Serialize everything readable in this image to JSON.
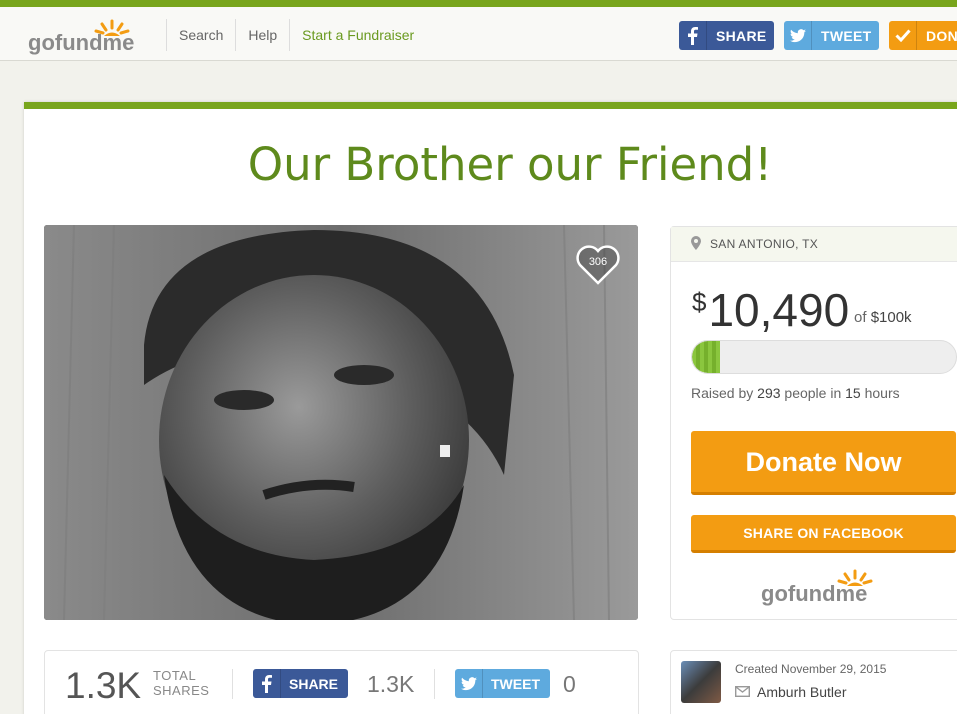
{
  "header": {
    "logo_text": "gofundme",
    "nav": [
      {
        "label": "Search"
      },
      {
        "label": "Help"
      },
      {
        "label": "Start a Fundraiser"
      }
    ],
    "share_label": "SHARE",
    "tweet_label": "TWEET",
    "donate_label": "DON"
  },
  "campaign": {
    "title": "Our Brother our Friend!",
    "heart_count": "306"
  },
  "sidebar": {
    "location": "SAN ANTONIO, TX",
    "currency": "$",
    "amount": "10,490",
    "goal_prefix": "of",
    "goal": "$100k",
    "progress_fraction": 0.105,
    "raised_prefix": "Raised by",
    "raised_people": "293",
    "raised_mid": "people in",
    "raised_hours": "15",
    "raised_suffix": "hours",
    "donate_label": "Donate Now",
    "share_fb_label": "SHARE ON FACEBOOK",
    "logo_text": "gofundme"
  },
  "share_bar": {
    "total_count": "1.3K",
    "total_label_1": "TOTAL",
    "total_label_2": "SHARES",
    "fb_label": "SHARE",
    "fb_count": "1.3K",
    "tw_label": "TWEET",
    "tw_count": "0"
  },
  "creator": {
    "created": "Created November 29, 2015",
    "name": "Amburh Butler"
  },
  "colors": {
    "brand_green": "#78a51c",
    "title_green": "#5e8a1c",
    "donate_orange": "#f39c12",
    "facebook_blue": "#3b5998",
    "twitter_blue": "#5eaade"
  }
}
